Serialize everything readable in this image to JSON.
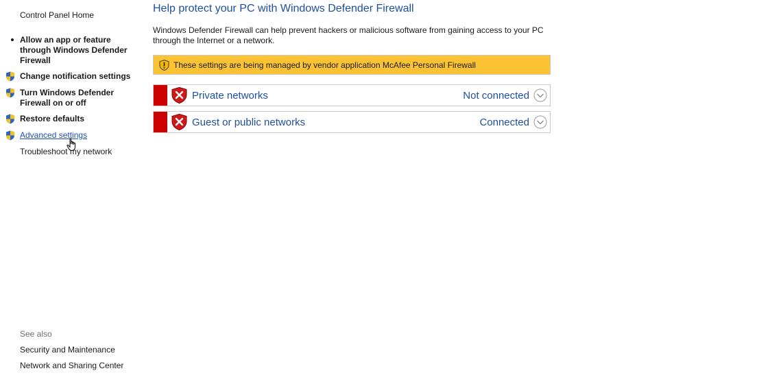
{
  "sidebar": {
    "home": "Control Panel Home",
    "items": [
      {
        "label": "Allow an app or feature through Windows Defender Firewall",
        "icon": "bullet"
      },
      {
        "label": "Change notification settings",
        "icon": "uac-shield-icon"
      },
      {
        "label": "Turn Windows Defender Firewall on or off",
        "icon": "uac-shield-icon"
      },
      {
        "label": "Restore defaults",
        "icon": "uac-shield-icon"
      },
      {
        "label": "Advanced settings",
        "icon": "uac-shield-icon"
      },
      {
        "label": "Troubleshoot my network",
        "icon": "none"
      }
    ],
    "see_also": {
      "heading": "See also",
      "links": [
        "Security and Maintenance",
        "Network and Sharing Center"
      ]
    }
  },
  "main": {
    "title": "Help protect your PC with Windows Defender Firewall",
    "description": "Windows Defender Firewall can help prevent hackers or malicious software from gaining access to your PC through the Internet or a network.",
    "banner": "These settings are being managed by vendor application McAfee  Personal Firewall",
    "networks": [
      {
        "name": "Private networks",
        "status": "Not connected"
      },
      {
        "name": "Guest or public networks",
        "status": "Connected"
      }
    ]
  },
  "colors": {
    "title_blue": "#1e4f9c",
    "banner_yellow": "#fbc334",
    "alert_red": "#cc0000"
  }
}
